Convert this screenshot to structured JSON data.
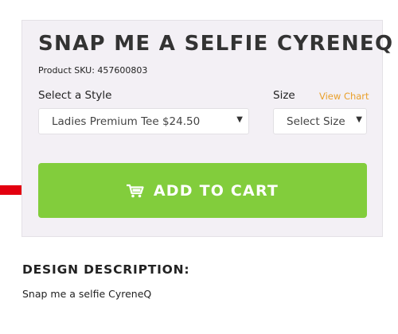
{
  "product": {
    "title": "SNAP ME A SELFIE CYRENEQ",
    "sku": "Product SKU: 457600803"
  },
  "style_selector": {
    "label": "Select a Style",
    "selected": "Ladies Premium Tee $24.50"
  },
  "size_selector": {
    "label": "Size",
    "view_chart": "View Chart",
    "selected": "Select Size"
  },
  "cart": {
    "button_label": "ADD TO CART",
    "icon": "shopping-cart-icon"
  },
  "annotation": {
    "icon": "red-arrow-icon",
    "color": "#e3000f"
  },
  "description": {
    "heading": "DESIGN DESCRIPTION:",
    "text": "Snap me a selfie CyreneQ"
  },
  "colors": {
    "button_green": "#82cd3c",
    "view_chart_orange": "#e9a02b",
    "card_background": "#f3f0f5"
  }
}
